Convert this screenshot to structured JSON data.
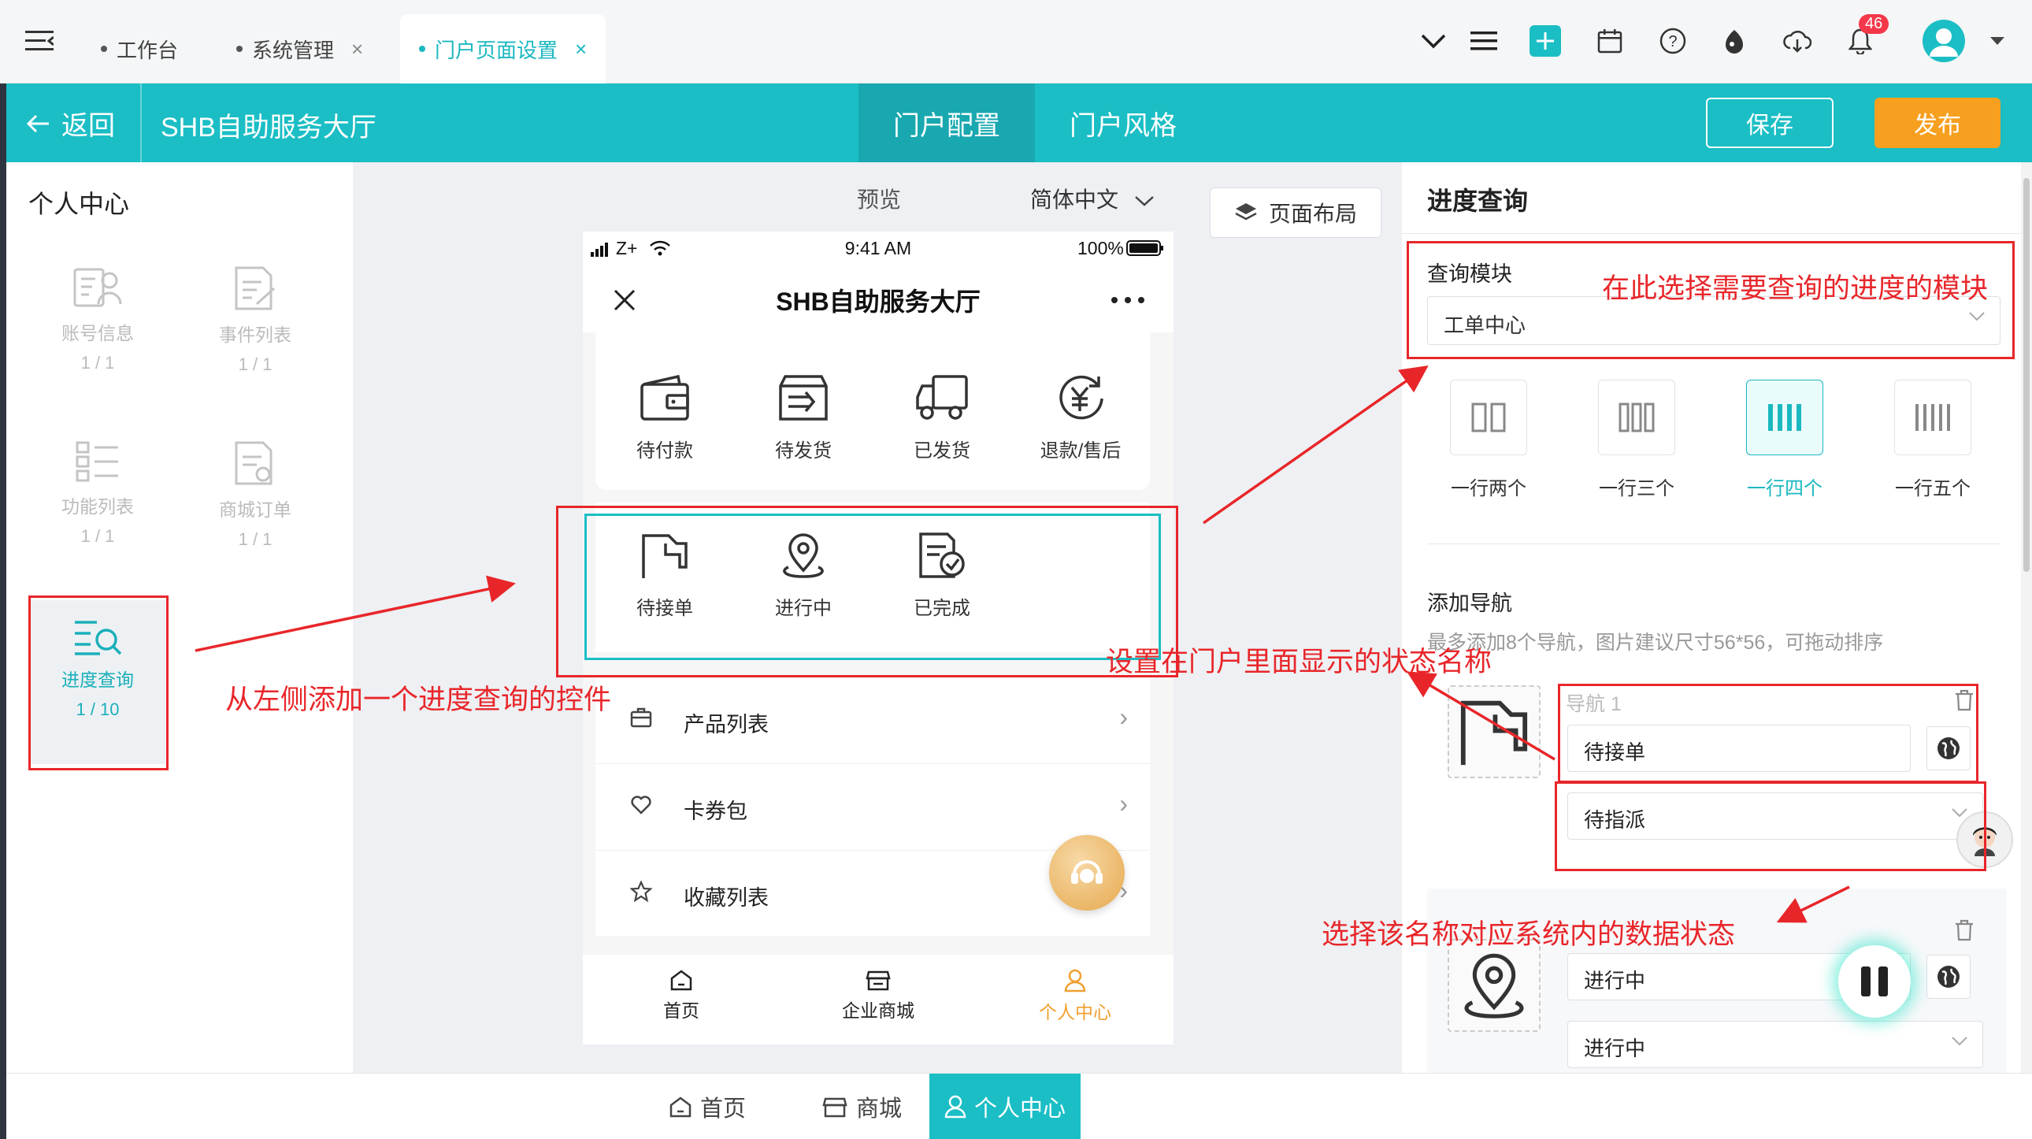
{
  "tabs": [
    {
      "label": "工作台",
      "closable": false,
      "active": false
    },
    {
      "label": "系统管理",
      "closable": true,
      "active": false
    },
    {
      "label": "门户页面设置",
      "closable": true,
      "active": true
    }
  ],
  "topbar": {
    "notification_count": "46"
  },
  "header": {
    "back_label": "返回",
    "title": "SHB自助服务大厅",
    "tab_config": "门户配置",
    "tab_style": "门户风格",
    "save_label": "保存",
    "publish_label": "发布"
  },
  "left_panel": {
    "title": "个人中心",
    "widgets": [
      {
        "label": "账号信息",
        "count": "1 / 1"
      },
      {
        "label": "事件列表",
        "count": "1 / 1"
      },
      {
        "label": "功能列表",
        "count": "1 / 1"
      },
      {
        "label": "商城订单",
        "count": "1 / 1"
      },
      {
        "label": "进度查询",
        "count": "1 / 10"
      }
    ]
  },
  "center": {
    "preview_label": "预览",
    "language": "简体中文",
    "layout_button": "页面布局"
  },
  "phone": {
    "status": {
      "signal": "Z+",
      "time": "9:41 AM",
      "battery": "100%"
    },
    "title": "SHB自助服务大厅",
    "order_items": [
      "待付款",
      "待发货",
      "已发货",
      "退款/售后"
    ],
    "progress_items": [
      "待接单",
      "进行中",
      "已完成"
    ],
    "menu_items": [
      "产品列表",
      "卡券包",
      "收藏列表"
    ],
    "bottom_tabs": [
      "首页",
      "企业商城",
      "个人中心"
    ]
  },
  "right_panel": {
    "title": "进度查询",
    "query_label": "查询模块",
    "query_value": "工单中心",
    "layout_options": [
      {
        "label": "一行两个",
        "active": false
      },
      {
        "label": "一行三个",
        "active": false
      },
      {
        "label": "一行四个",
        "active": true
      },
      {
        "label": "一行五个",
        "active": false
      }
    ],
    "nav_label": "添加导航",
    "nav_hint": "最多添加8个导航，图片建议尺寸56*56，可拖动排序",
    "nav_items": [
      {
        "title": "导航 1",
        "text": "待接单",
        "status": "待指派"
      },
      {
        "title": "",
        "text": "进行中",
        "status": "进行中"
      }
    ]
  },
  "app_bottom": {
    "tabs": [
      "首页",
      "商城",
      "个人中心"
    ]
  },
  "annotations": {
    "left": "从左侧添加一个进度查询的控件",
    "module": "在此选择需要查询的进度的模块",
    "status_name": "设置在门户里面显示的状态名称",
    "data_status": "选择该名称对应系统内的数据状态"
  },
  "colors": {
    "accent": "#1bbec5",
    "publish": "#f7a020",
    "annotation": "#e8262a"
  }
}
